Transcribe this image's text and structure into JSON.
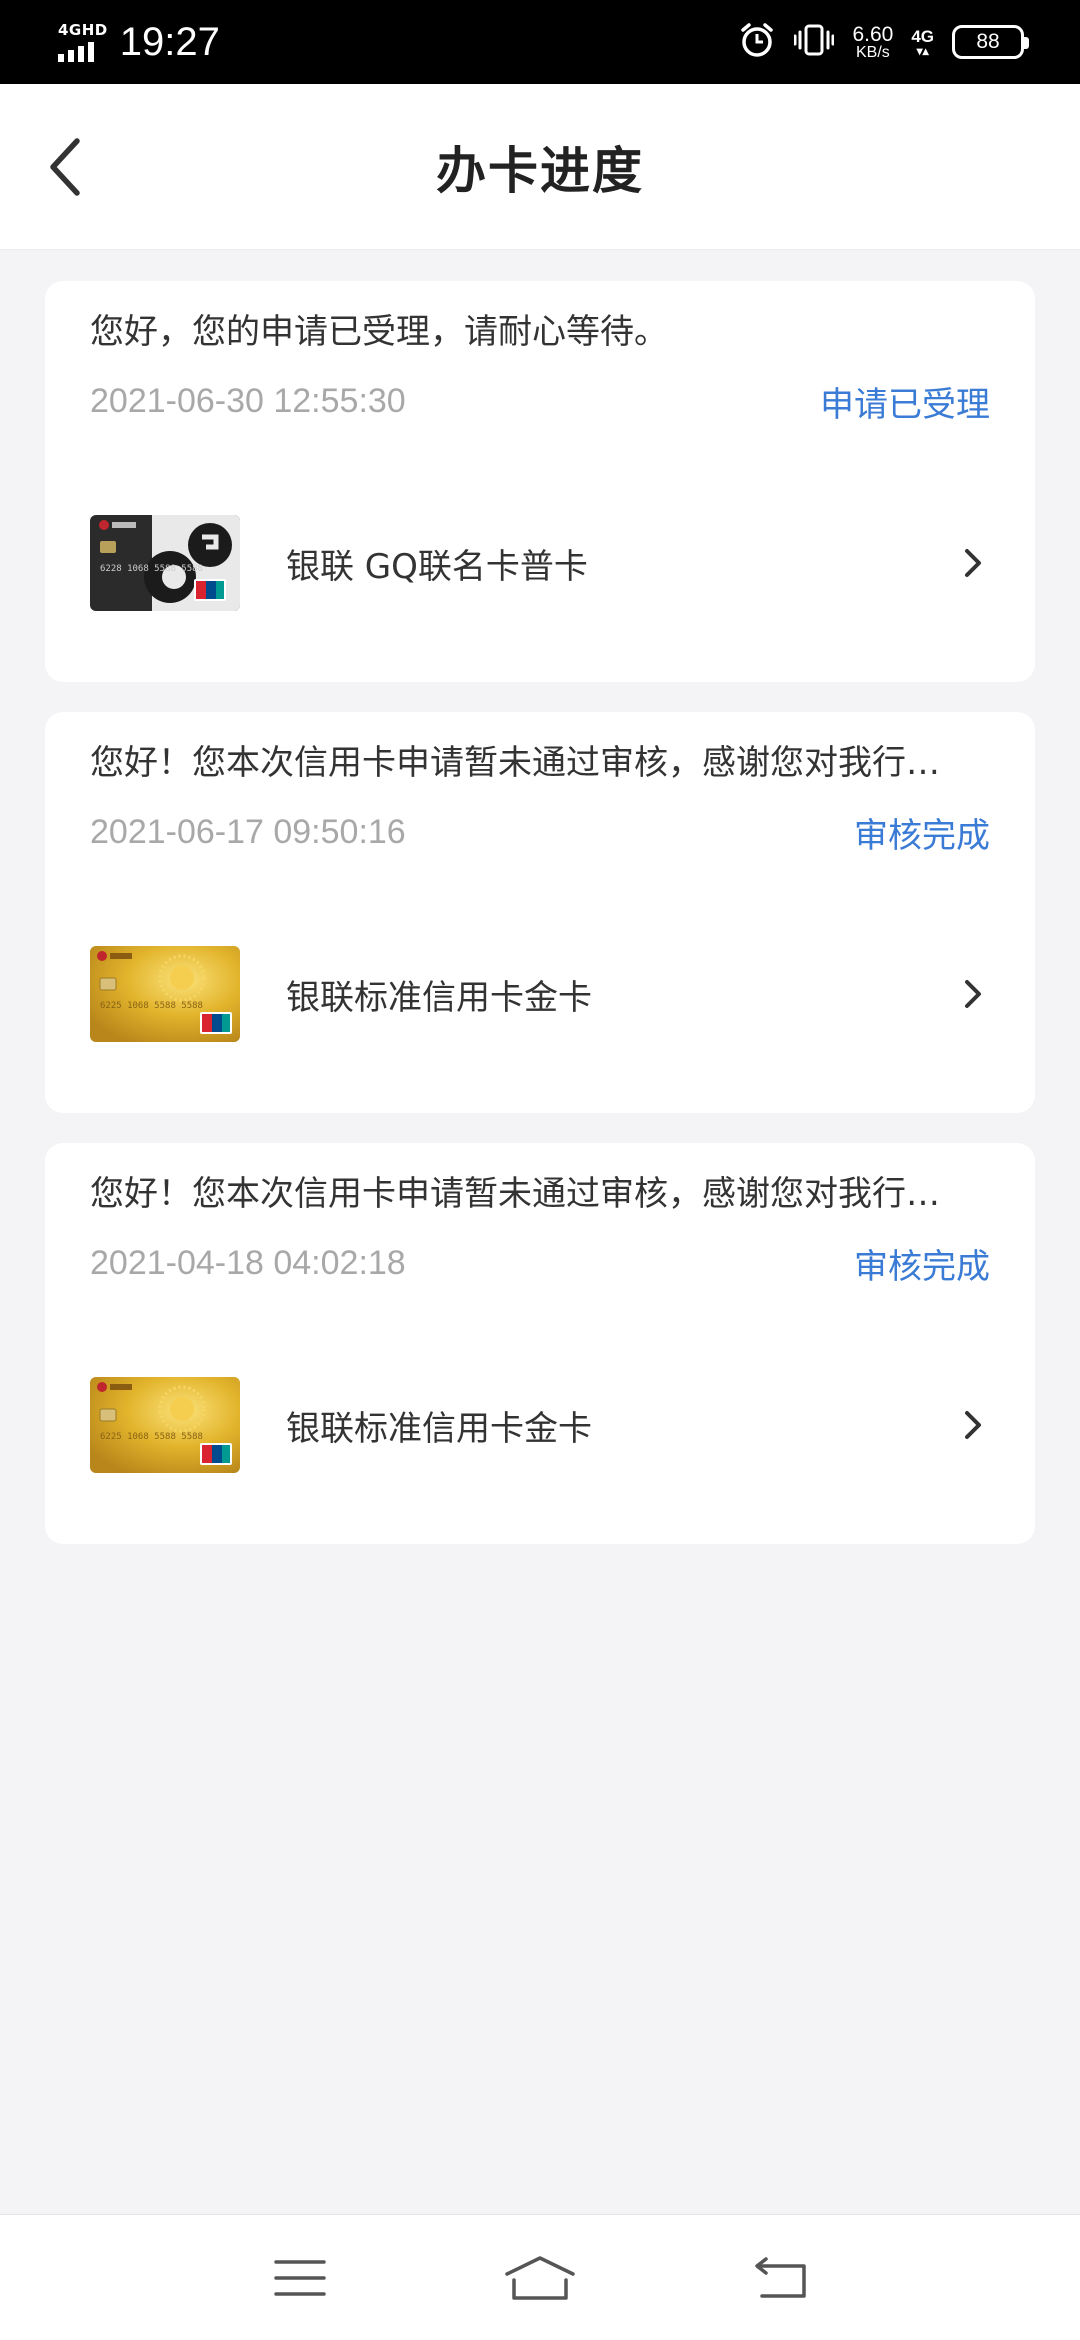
{
  "status_bar": {
    "network": "4GHD",
    "time": "19:27",
    "speed_value": "6.60",
    "speed_unit": "KB/s",
    "mobile_data": "4G",
    "battery": "88",
    "icons": [
      "signal-icon",
      "alarm-icon",
      "vibrate-icon",
      "battery-icon"
    ]
  },
  "header": {
    "title": "办卡进度",
    "back_icon": "chevron-left-icon"
  },
  "applications": [
    {
      "message": "您好，您的申请已受理，请耐心等待。",
      "date": "2021-06-30 12:55:30",
      "status": "申请已受理",
      "card_name": "银联 GQ联名卡普卡",
      "card_style": "gq-black"
    },
    {
      "message": "您好！您本次信用卡申请暂未通过审核，感谢您对我行…",
      "date": "2021-06-17 09:50:16",
      "status": "审核完成",
      "card_name": "银联标准信用卡金卡",
      "card_style": "gold"
    },
    {
      "message": "您好！您本次信用卡申请暂未通过审核，感谢您对我行…",
      "date": "2021-04-18 04:02:18",
      "status": "审核完成",
      "card_name": "银联标准信用卡金卡",
      "card_style": "gold"
    }
  ],
  "colors": {
    "accent": "#3a7bd5",
    "date_gray": "#a8a8a8",
    "background": "#f4f4f6"
  },
  "bottom_nav": [
    "menu-icon",
    "home-icon",
    "back-icon"
  ]
}
